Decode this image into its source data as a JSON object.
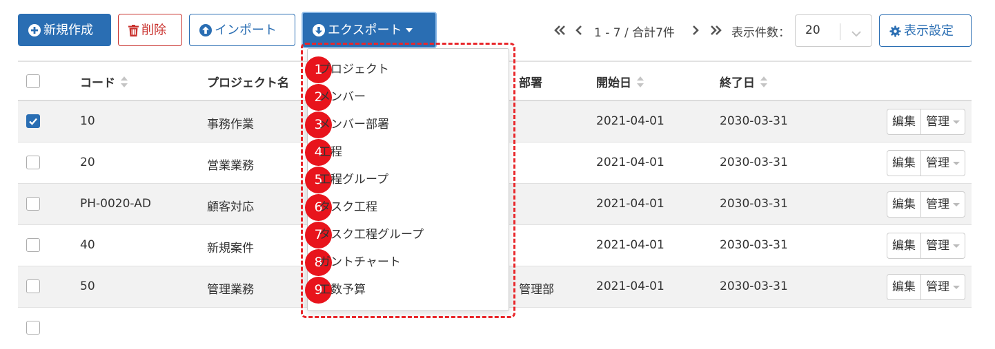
{
  "toolbar": {
    "new_label": "新規作成",
    "delete_label": "削除",
    "import_label": "インポート",
    "export_label": "エクスポート",
    "settings_label": "表示設定"
  },
  "pager": {
    "range_text": "1 - 7 / 合計7件",
    "per_page_label": "表示件数：",
    "per_page_value": "20"
  },
  "table": {
    "headers": {
      "code": "コード",
      "project_name": "プロジェクト名",
      "department": "部署",
      "start_date": "開始日",
      "end_date": "終了日"
    },
    "edit_label": "編集",
    "manage_label": "管理",
    "rows": [
      {
        "code": "10",
        "name": "事務作業",
        "department": "",
        "start": "2021-04-01",
        "end": "2030-03-31",
        "checked": true
      },
      {
        "code": "20",
        "name": "営業業務",
        "department": "",
        "start": "2021-04-01",
        "end": "2030-03-31",
        "checked": false
      },
      {
        "code": "PH-0020-AD",
        "name": "顧客対応",
        "department": "",
        "start": "2021-04-01",
        "end": "2030-03-31",
        "checked": false
      },
      {
        "code": "40",
        "name": "新規案件",
        "department": "",
        "start": "2021-04-01",
        "end": "2030-03-31",
        "checked": false
      },
      {
        "code": "50",
        "name": "管理業務",
        "department": "管理部",
        "start": "2021-04-01",
        "end": "2030-03-31",
        "checked": false
      }
    ]
  },
  "export_menu": {
    "items": [
      {
        "number": "1",
        "label": "プロジェクト"
      },
      {
        "number": "2",
        "label": "メンバー"
      },
      {
        "number": "3",
        "label": "メンバー部署"
      },
      {
        "number": "4",
        "label": "工程"
      },
      {
        "number": "5",
        "label": "工程グループ"
      },
      {
        "number": "6",
        "label": "タスク工程"
      },
      {
        "number": "7",
        "label": "タスク工程グループ"
      },
      {
        "number": "8",
        "label": "ガントチャート"
      },
      {
        "number": "9",
        "label": "工数予算"
      }
    ]
  },
  "colors": {
    "primary": "#2a6eb3",
    "danger": "#c9302c",
    "annotation_red": "#e8262a"
  }
}
